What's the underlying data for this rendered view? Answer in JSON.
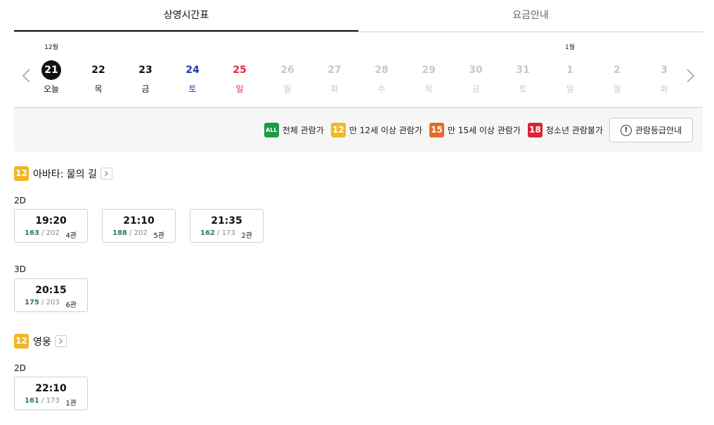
{
  "tabs": [
    {
      "label": "상영시간표",
      "active": true
    },
    {
      "label": "요금안내",
      "active": false
    }
  ],
  "dates": [
    {
      "month": "12월",
      "num": "21",
      "weekday": "오늘",
      "state": "today"
    },
    {
      "month": "",
      "num": "22",
      "weekday": "목",
      "state": "normal"
    },
    {
      "month": "",
      "num": "23",
      "weekday": "금",
      "state": "normal"
    },
    {
      "month": "",
      "num": "24",
      "weekday": "토",
      "state": "sat"
    },
    {
      "month": "",
      "num": "25",
      "weekday": "일",
      "state": "sun"
    },
    {
      "month": "",
      "num": "26",
      "weekday": "월",
      "state": "disabled"
    },
    {
      "month": "",
      "num": "27",
      "weekday": "화",
      "state": "disabled"
    },
    {
      "month": "",
      "num": "28",
      "weekday": "수",
      "state": "disabled"
    },
    {
      "month": "",
      "num": "29",
      "weekday": "목",
      "state": "disabled"
    },
    {
      "month": "",
      "num": "30",
      "weekday": "금",
      "state": "disabled"
    },
    {
      "month": "",
      "num": "31",
      "weekday": "토",
      "state": "disabled"
    },
    {
      "month": "1월",
      "num": "1",
      "weekday": "일",
      "state": "disabled"
    },
    {
      "month": "",
      "num": "2",
      "weekday": "월",
      "state": "disabled"
    },
    {
      "month": "",
      "num": "3",
      "weekday": "화",
      "state": "disabled"
    }
  ],
  "legend": [
    {
      "badge": "ALL",
      "cls": "all",
      "label": "전체 관람가"
    },
    {
      "badge": "12",
      "cls": "b12",
      "label": "만 12세 이상 관람가"
    },
    {
      "badge": "15",
      "cls": "b15",
      "label": "만 15세 이상 관람가"
    },
    {
      "badge": "18",
      "cls": "b18",
      "label": "청소년 관람불가"
    }
  ],
  "grade_button": {
    "icon": "!",
    "label": "관람등급안내"
  },
  "movies": [
    {
      "title": "아바타: 물의 길",
      "rating": "12",
      "formats": [
        {
          "name": "2D",
          "showtimes": [
            {
              "time": "19:20",
              "remaining": "163",
              "total": "202",
              "screen": "4관"
            },
            {
              "time": "21:10",
              "remaining": "188",
              "total": "202",
              "screen": "5관"
            },
            {
              "time": "21:35",
              "remaining": "162",
              "total": "173",
              "screen": "2관"
            }
          ]
        },
        {
          "name": "3D",
          "showtimes": [
            {
              "time": "20:15",
              "remaining": "175",
              "total": "203",
              "screen": "6관"
            }
          ]
        }
      ]
    },
    {
      "title": "영웅",
      "rating": "12",
      "formats": [
        {
          "name": "2D",
          "showtimes": [
            {
              "time": "22:10",
              "remaining": "161",
              "total": "173",
              "screen": "1관"
            }
          ]
        }
      ]
    }
  ],
  "colors": {
    "rating_all": "#1b9a48",
    "rating_12": "#f0b823",
    "rating_15": "#e26c27",
    "rating_18": "#d9263a",
    "saturday": "#1e3aa8",
    "sunday": "#e0284a",
    "remaining_seats": "#2a7a52"
  }
}
